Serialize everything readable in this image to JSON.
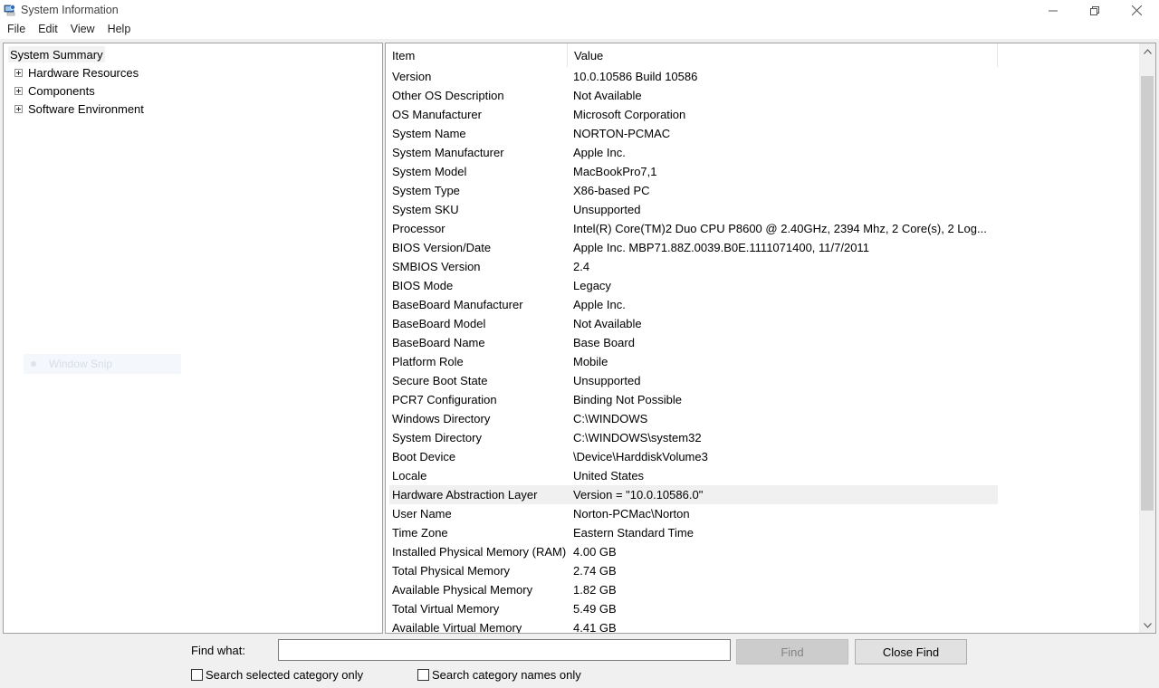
{
  "window": {
    "title": "System Information",
    "minimize_glyph": "—",
    "restore_glyph": "❐",
    "close_glyph": "✕"
  },
  "menu": [
    "File",
    "Edit",
    "View",
    "Help"
  ],
  "tree": {
    "root": "System Summary",
    "children": [
      "Hardware Resources",
      "Components",
      "Software Environment"
    ]
  },
  "snip_ghost": "Window Snip",
  "list": {
    "headers": {
      "item": "Item",
      "value": "Value"
    },
    "rows": [
      {
        "item": "Version",
        "value": "10.0.10586 Build 10586"
      },
      {
        "item": "Other OS Description",
        "value": "Not Available"
      },
      {
        "item": "OS Manufacturer",
        "value": "Microsoft Corporation"
      },
      {
        "item": "System Name",
        "value": "NORTON-PCMAC"
      },
      {
        "item": "System Manufacturer",
        "value": "Apple Inc."
      },
      {
        "item": "System Model",
        "value": "MacBookPro7,1"
      },
      {
        "item": "System Type",
        "value": "X86-based PC"
      },
      {
        "item": "System SKU",
        "value": "Unsupported"
      },
      {
        "item": "Processor",
        "value": "Intel(R) Core(TM)2 Duo CPU     P8600  @ 2.40GHz, 2394 Mhz, 2 Core(s), 2 Log..."
      },
      {
        "item": "BIOS Version/Date",
        "value": "Apple Inc. MBP71.88Z.0039.B0E.1111071400, 11/7/2011"
      },
      {
        "item": "SMBIOS Version",
        "value": "2.4"
      },
      {
        "item": "BIOS Mode",
        "value": "Legacy"
      },
      {
        "item": "BaseBoard Manufacturer",
        "value": "Apple Inc."
      },
      {
        "item": "BaseBoard Model",
        "value": "Not Available"
      },
      {
        "item": "BaseBoard Name",
        "value": "Base Board"
      },
      {
        "item": "Platform Role",
        "value": "Mobile"
      },
      {
        "item": "Secure Boot State",
        "value": "Unsupported"
      },
      {
        "item": "PCR7 Configuration",
        "value": "Binding Not Possible"
      },
      {
        "item": "Windows Directory",
        "value": "C:\\WINDOWS"
      },
      {
        "item": "System Directory",
        "value": "C:\\WINDOWS\\system32"
      },
      {
        "item": "Boot Device",
        "value": "\\Device\\HarddiskVolume3"
      },
      {
        "item": "Locale",
        "value": "United States"
      },
      {
        "item": "Hardware Abstraction Layer",
        "value": "Version = \"10.0.10586.0\""
      },
      {
        "item": "User Name",
        "value": "Norton-PCMac\\Norton"
      },
      {
        "item": "Time Zone",
        "value": "Eastern Standard Time"
      },
      {
        "item": "Installed Physical Memory (RAM)",
        "value": "4.00 GB"
      },
      {
        "item": "Total Physical Memory",
        "value": "2.74 GB"
      },
      {
        "item": "Available Physical Memory",
        "value": "1.82 GB"
      },
      {
        "item": "Total Virtual Memory",
        "value": "5.49 GB"
      },
      {
        "item": "Available Virtual Memory",
        "value": "4.41 GB"
      }
    ],
    "selected_index": 22
  },
  "find": {
    "label": "Find what:",
    "value": "",
    "placeholder": "",
    "find_button": "Find",
    "close_button": "Close Find",
    "checkbox_selected_category": "Search selected category only",
    "checkbox_category_names": "Search category names only"
  }
}
